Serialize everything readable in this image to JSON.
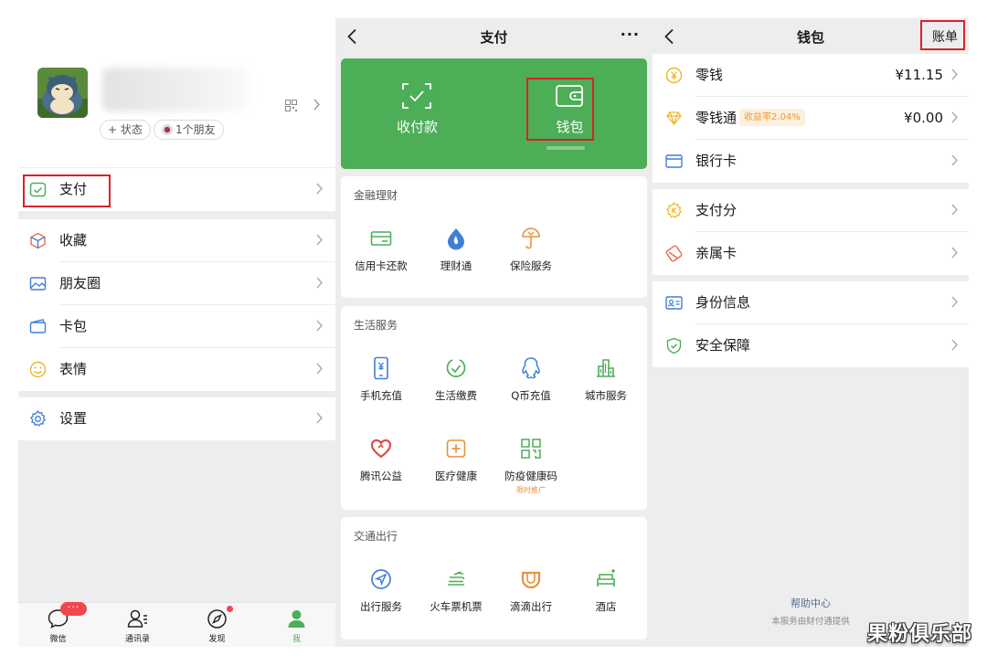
{
  "me_screen": {
    "status_chip": "+ 状态",
    "friends_chip": "1个朋友",
    "menu": [
      {
        "label": "支付",
        "icon": "pay-icon"
      },
      {
        "label": "收藏",
        "icon": "favorites-icon"
      },
      {
        "label": "朋友圈",
        "icon": "moments-icon"
      },
      {
        "label": "卡包",
        "icon": "card-wallet-icon"
      },
      {
        "label": "表情",
        "icon": "sticker-icon"
      },
      {
        "label": "设置",
        "icon": "settings-icon"
      }
    ],
    "tabs": [
      {
        "label": "微信",
        "badge": "···"
      },
      {
        "label": "通讯录"
      },
      {
        "label": "发现"
      },
      {
        "label": "我"
      }
    ]
  },
  "pay_screen": {
    "title": "支付",
    "more": "···",
    "header_tiles": [
      {
        "label": "收付款",
        "icon": "scan-pay-icon"
      },
      {
        "label": "钱包",
        "icon": "wallet-icon"
      }
    ],
    "sections": [
      {
        "title": "金融理财",
        "items": [
          {
            "label": "信用卡还款",
            "icon": "credit-card-icon"
          },
          {
            "label": "理财通",
            "icon": "wealth-icon"
          },
          {
            "label": "保险服务",
            "icon": "insurance-icon"
          }
        ]
      },
      {
        "title": "生活服务",
        "items": [
          {
            "label": "手机充值",
            "icon": "phone-topup-icon"
          },
          {
            "label": "生活缴费",
            "icon": "utility-bill-icon"
          },
          {
            "label": "Q币充值",
            "icon": "qcoin-icon"
          },
          {
            "label": "城市服务",
            "icon": "city-service-icon"
          },
          {
            "label": "腾讯公益",
            "icon": "charity-icon"
          },
          {
            "label": "医疗健康",
            "icon": "medical-icon"
          },
          {
            "label": "防疫健康码",
            "icon": "health-code-icon",
            "sub": "限时推广"
          }
        ]
      },
      {
        "title": "交通出行",
        "items": [
          {
            "label": "出行服务",
            "icon": "travel-icon"
          },
          {
            "label": "火车票机票",
            "icon": "train-ticket-icon"
          },
          {
            "label": "滴滴出行",
            "icon": "didi-icon"
          },
          {
            "label": "酒店",
            "icon": "hotel-icon"
          }
        ]
      }
    ]
  },
  "wallet_screen": {
    "title": "钱包",
    "bill_button": "账单",
    "rows": [
      {
        "label": "零钱",
        "value": "¥11.15",
        "icon": "coin-icon"
      },
      {
        "label": "零钱通",
        "badge": "收益率2.04%",
        "value": "¥0.00",
        "icon": "diamond-icon"
      },
      {
        "label": "银行卡",
        "icon": "bank-card-icon"
      },
      {
        "label": "支付分",
        "icon": "pay-score-icon"
      },
      {
        "label": "亲属卡",
        "icon": "family-card-icon"
      },
      {
        "label": "身份信息",
        "icon": "id-card-icon"
      },
      {
        "label": "安全保障",
        "icon": "shield-icon"
      }
    ],
    "help_center": "帮助中心",
    "footer": "本服务由财付通提供"
  },
  "watermark": "果粉俱乐部",
  "colors": {
    "wechat_green": "#4dae58",
    "highlight_red": "#d9212b",
    "badge_red": "#f2474d",
    "background_gray": "#ededed",
    "link_blue": "#576b95"
  }
}
